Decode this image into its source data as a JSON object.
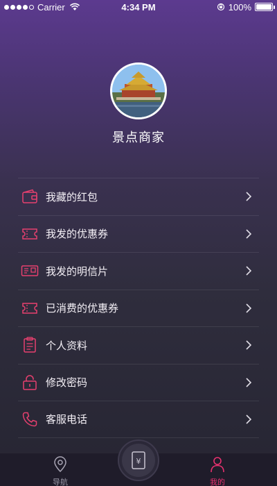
{
  "status_bar": {
    "carrier": "Carrier",
    "time": "4:34 PM",
    "battery": "100%"
  },
  "profile": {
    "name": "景点商家"
  },
  "menu": {
    "items": [
      {
        "label": "我藏的红包",
        "icon": "wallet-icon"
      },
      {
        "label": "我发的优惠券",
        "icon": "coupon-icon"
      },
      {
        "label": "我发的明信片",
        "icon": "postcard-icon"
      },
      {
        "label": "已消费的优惠券",
        "icon": "used-coupon-icon"
      },
      {
        "label": "个人资料",
        "icon": "clipboard-icon"
      },
      {
        "label": "修改密码",
        "icon": "lock-icon"
      },
      {
        "label": "客服电话",
        "icon": "phone-icon"
      }
    ]
  },
  "tab_bar": {
    "nav_label": "导航",
    "center_icon": "red-packet-icon",
    "mine_label": "我的"
  },
  "colors": {
    "accent": "#e8316f",
    "icon_stroke": "#e8406f"
  }
}
